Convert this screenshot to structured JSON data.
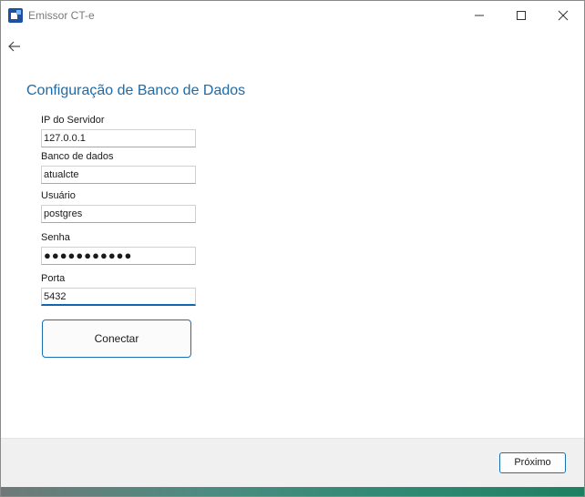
{
  "window": {
    "title": "Emissor CT-e"
  },
  "page": {
    "heading": "Configuração de Banco de Dados"
  },
  "form": {
    "ip": {
      "label": "IP do Servidor",
      "value": "127.0.0.1"
    },
    "db": {
      "label": "Banco de dados",
      "value": "atualcte"
    },
    "user": {
      "label": "Usuário",
      "value": "postgres"
    },
    "password": {
      "label": "Senha",
      "value": "●●●●●●●●●●●"
    },
    "port": {
      "label": "Porta",
      "value": "5432"
    },
    "connect_label": "Conectar"
  },
  "footer": {
    "next_label": "Próximo"
  },
  "colors": {
    "accent": "#1f6aa5",
    "button_border": "#1b6fb5",
    "footer_bg": "#f0f0f0"
  },
  "icons": [
    "app-icon",
    "minimize-icon",
    "maximize-icon",
    "close-icon",
    "back-arrow-icon"
  ]
}
